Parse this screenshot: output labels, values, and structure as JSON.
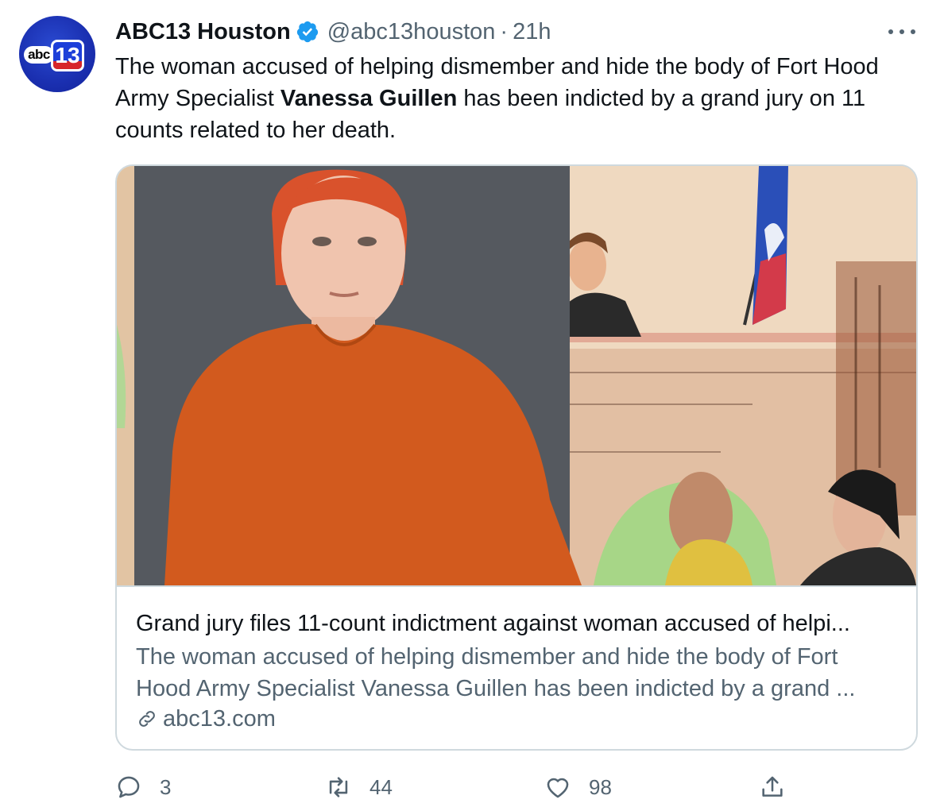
{
  "tweet": {
    "author": {
      "display_name": "ABC13 Houston",
      "handle": "@abc13houston",
      "separator": "·",
      "time": "21h",
      "avatar_logo_text": [
        "abc",
        "13"
      ],
      "verified_icon": "verified-badge-icon"
    },
    "text": {
      "part1": "The woman accused of helping dismember and hide the body of Fort Hood Army Specialist ",
      "bold": "Vanessa Guillen",
      "part2": " has been indicted by a grand jury on 11 counts related to her death."
    },
    "card": {
      "title": "Grand jury files 11-count indictment against woman accused of helpi...",
      "description": "The woman accused of helping dismember and hide the body of Fort Hood Army Specialist Vanessa Guillen has been indicted by a grand ...",
      "domain": "abc13.com"
    },
    "actions": {
      "replies": "3",
      "retweets": "44",
      "likes": "98"
    }
  },
  "colors": {
    "text_primary": "#0f1419",
    "text_secondary": "#536471",
    "verified_blue": "#1d9bf0",
    "border": "#cfd9de",
    "avatar_blue": "#1a2fb0"
  }
}
